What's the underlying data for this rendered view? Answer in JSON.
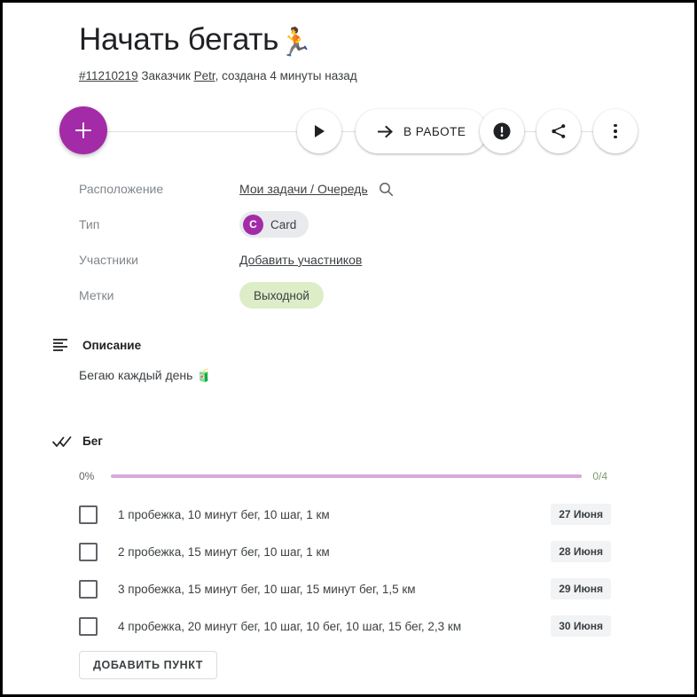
{
  "header": {
    "title": "Начать бегать",
    "title_emoji": "🏃",
    "task_id": "#11210219",
    "requester_label": "Заказчик",
    "requester_name": "Petr",
    "created_text": ", создана 4 минуты назад"
  },
  "actions": {
    "add_label": "+",
    "play_label": "▶",
    "status_label": "В РАБОТЕ",
    "status_arrow": "→",
    "alert_label": "!",
    "share_label": "share-icon",
    "more_label": "more-vertical-icon"
  },
  "properties": [
    {
      "label": "Расположение",
      "value": "Мои задачи / Очередь",
      "kind": "link",
      "has_search": true
    },
    {
      "label": "Тип",
      "value": "Card",
      "kind": "chip-avatar",
      "avatar_letter": "C"
    },
    {
      "label": "Участники",
      "value": "Добавить участников",
      "kind": "link",
      "has_search": false
    },
    {
      "label": "Метки",
      "value": "Выходной",
      "kind": "tag"
    }
  ],
  "description": {
    "heading": "Описание",
    "text": "Бегаю каждый день ",
    "emoji": "🧃"
  },
  "checklist": {
    "heading": "Бег",
    "progress_percent": "0%",
    "progress_count": "0/4",
    "progress_value": 0,
    "items": [
      {
        "text": "1 пробежка, 10 минут бег, 10 шаг, 1 км",
        "date": "27 Июня",
        "checked": false
      },
      {
        "text": "2 пробежка, 15 минут бег, 10 шаг, 1 км",
        "date": "28 Июня",
        "checked": false
      },
      {
        "text": "3 пробежка, 15 минут бег, 10 шаг, 15 минут бег, 1,5 км",
        "date": "29 Июня",
        "checked": false
      },
      {
        "text": "4 пробежка, 20 минут бег, 10 шаг, 10 бег, 10 шаг, 15 бег, 2,3 км",
        "date": "30 Июня",
        "checked": false
      }
    ],
    "add_button_label": "ДОБАВИТЬ ПУНКТ"
  },
  "colors": {
    "accent_purple": "#A32BA8",
    "tag_green": "#DCEDC8",
    "progress_track": "#D8A8DC",
    "badge_gray": "#F1F3F4"
  }
}
